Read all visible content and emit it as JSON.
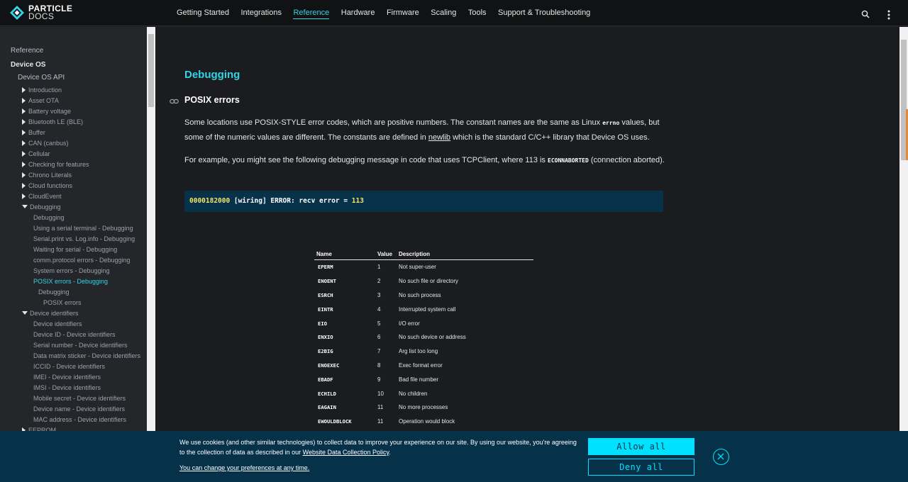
{
  "brand": {
    "line1": "PARTICLE",
    "line2": "DOCS"
  },
  "nav": [
    {
      "label": "Getting Started",
      "active": false
    },
    {
      "label": "Integrations",
      "active": false
    },
    {
      "label": "Reference",
      "active": true
    },
    {
      "label": "Hardware",
      "active": false
    },
    {
      "label": "Firmware",
      "active": false
    },
    {
      "label": "Scaling",
      "active": false
    },
    {
      "label": "Tools",
      "active": false
    },
    {
      "label": "Support & Troubleshooting",
      "active": false
    }
  ],
  "sidebar": {
    "heading": "Reference",
    "section": "Device OS",
    "subsection": "Device OS API",
    "items": [
      "Introduction",
      "Asset OTA",
      "Battery voltage",
      "Bluetooth LE (BLE)",
      "Buffer",
      "CAN (canbus)",
      "Cellular",
      "Checking for features",
      "Chrono Literals",
      "Cloud functions",
      "CloudEvent",
      "Debugging"
    ],
    "debugging_children": [
      "Debugging",
      "Using a serial terminal - Debugging",
      "Serial.print vs. Log.info - Debugging",
      "Waiting for serial - Debugging",
      "comm.protocol errors - Debugging",
      "System errors - Debugging",
      "POSIX errors - Debugging"
    ],
    "posix_children": [
      "Debugging",
      "POSIX errors"
    ],
    "device_identifiers": "Device identifiers",
    "device_identifiers_children": [
      "Device identifiers",
      "Device ID - Device identifiers",
      "Serial number - Device identifiers",
      "Data matrix sticker - Device identifiers",
      "ICCID - Device identifiers",
      "IMEI - Device identifiers",
      "IMSI - Device identifiers",
      "Mobile secret - Device identifiers",
      "Device name - Device identifiers",
      "MAC address - Device identifiers"
    ],
    "eeprom": "EEPROM"
  },
  "content": {
    "h1": "Debugging",
    "h2": "POSIX errors",
    "p1_a": "Some locations use POSIX-STYLE error codes, which are positive numbers. The constant names are the same as Linux ",
    "p1_code": "errno",
    "p1_b": " values, but some of the numeric values are different. The constants are defined in ",
    "p1_link": "newlib",
    "p1_c": " which is the standard C/C++ library that Device OS uses.",
    "p2_a": "For example, you might see the following debugging message in code that uses TCPClient, where 113 is ",
    "p2_code": "ECONNABORTED",
    "p2_b": " (connection aborted).",
    "code_num": "0000182000",
    "code_text": " [wiring] ERROR: recv error = ",
    "code_val": "113"
  },
  "table": {
    "headers": [
      "Name",
      "Value",
      "Description"
    ],
    "rows": [
      [
        "EPERM",
        "1",
        "Not super-user"
      ],
      [
        "ENOENT",
        "2",
        "No such file or directory"
      ],
      [
        "ESRCH",
        "3",
        "No such process"
      ],
      [
        "EINTR",
        "4",
        "Interrupted system call"
      ],
      [
        "EIO",
        "5",
        "I/O error"
      ],
      [
        "ENXIO",
        "6",
        "No such device or address"
      ],
      [
        "E2BIG",
        "7",
        "Arg list too long"
      ],
      [
        "ENOEXEC",
        "8",
        "Exec format error"
      ],
      [
        "EBADF",
        "9",
        "Bad file number"
      ],
      [
        "ECHILD",
        "10",
        "No children"
      ],
      [
        "EAGAIN",
        "11",
        "No more processes"
      ],
      [
        "EWOULDBLOCK",
        "11",
        "Operation would block"
      ]
    ]
  },
  "cookie": {
    "text": "We use cookies (and other similar technologies) to collect data to improve your experience on our site. By using our website, you're agreeing to the collection of data as described in our ",
    "policy_link": "Website Data Collection Policy",
    "text_end": ".",
    "change_link": "You can change your preferences at any time.",
    "allow": "Allow all",
    "deny": "Deny all"
  },
  "colors": {
    "accent": "#34d3e6",
    "banner": "#063249",
    "button": "#00e1ff"
  }
}
